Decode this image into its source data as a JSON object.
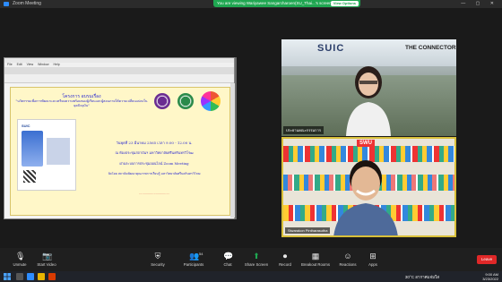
{
  "window": {
    "title": "Zoom Meeting"
  },
  "view_banner": {
    "text": "You are viewing Wariyawee Sangarcharoen(SU_Thai...'s screen",
    "options_label": "View Options",
    "accent": "#1fa751"
  },
  "shared_screen": {
    "app_title": "",
    "menu": "File Edit View Window Help",
    "doc_lines": [
      "โครงการ อบรมเรื่อง",
      "\"นวัตกรรมเพื่อการพัฒนาและเตรียมความพร้อมของผู้เรียนและผู้สอนภายใต้ความเปลี่ยนแปลงในยุคปัจจุบัน\"",
      "วันพุธที่ 23 มีนาคม 2565 เวลา 9.00 - 12.00 น.",
      "ณ ห้องประชุมสถาบันฯ มหาวิทยาลัยศรีนครินทรวิโรฒ",
      "ผ่านระบบการประชุมออนไลน์ Zoom Meeting",
      "จัดโดย สถาบันพัฒนาคุณภาพการเรียนรู้ มหาวิทยาลัยศรีนครินทรวิโรฒ"
    ],
    "poster_label": "SUIC"
  },
  "participants": [
    {
      "name": "ประธานคณะกรรมการ",
      "banner_top": "SUIC",
      "banner_right": "THE CONNECTOR"
    },
    {
      "name": "Siwarakon Pintharasutha",
      "banner": "SWU"
    }
  ],
  "toolbar": {
    "items": [
      {
        "label": "Unmute",
        "icon": "microphone-muted-icon",
        "glyph": "🎙"
      },
      {
        "label": "Start Video",
        "icon": "video-off-icon",
        "glyph": "📷"
      },
      {
        "label": "Security",
        "icon": "shield-icon",
        "glyph": "⛨"
      },
      {
        "label": "Participants",
        "icon": "people-icon",
        "glyph": "👥",
        "badge": "54"
      },
      {
        "label": "Chat",
        "icon": "chat-icon",
        "glyph": "💬"
      },
      {
        "label": "Share Screen",
        "icon": "share-screen-icon",
        "glyph": "⬆",
        "color": "#1fa751"
      },
      {
        "label": "Record",
        "icon": "record-icon",
        "glyph": "⏺"
      },
      {
        "label": "Breakout Rooms",
        "icon": "breakout-rooms-icon",
        "glyph": "▦"
      },
      {
        "label": "Reactions",
        "icon": "reactions-icon",
        "glyph": "☺"
      },
      {
        "label": "Apps",
        "icon": "apps-icon",
        "glyph": "⊞"
      }
    ],
    "leave_label": "Leave",
    "leave_color": "#e02828"
  },
  "taskbar": {
    "weather": "30°C อากาศแจ่มใส",
    "time": "9:00 AM",
    "date": "3/23/2022"
  }
}
